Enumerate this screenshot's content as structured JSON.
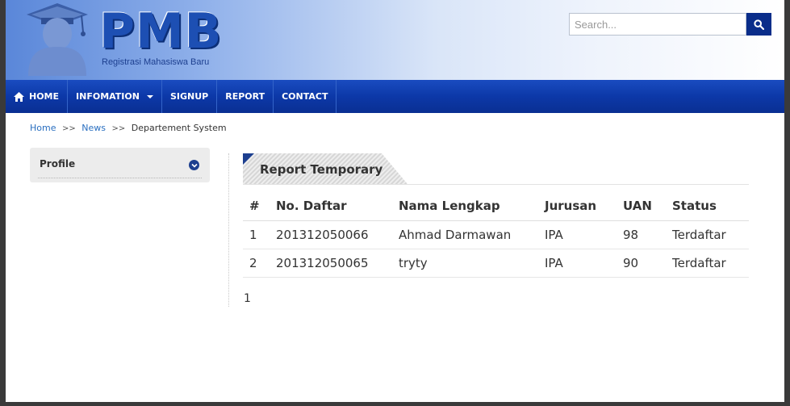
{
  "header": {
    "logo_text": "PMB",
    "logo_subtitle": "Registrasi Mahasiswa Baru",
    "search_placeholder": "Search..."
  },
  "nav": {
    "items": [
      {
        "label": "HOME"
      },
      {
        "label": "INFOMATION"
      },
      {
        "label": "SIGNUP"
      },
      {
        "label": "REPORT"
      },
      {
        "label": "CONTACT"
      }
    ]
  },
  "breadcrumb": {
    "items": [
      "Home",
      "News",
      "Departement System"
    ],
    "separator": ">>"
  },
  "sidebar": {
    "title": "Profile"
  },
  "main": {
    "heading": "Report Temporary",
    "table": {
      "headers": [
        "#",
        "No. Daftar",
        "Nama Lengkap",
        "Jurusan",
        "UAN",
        "Status"
      ],
      "rows": [
        [
          "1",
          "201312050066",
          "Ahmad Darmawan",
          "IPA",
          "98",
          "Terdaftar"
        ],
        [
          "2",
          "201312050065",
          "tryty",
          "IPA",
          "90",
          "Terdaftar"
        ]
      ]
    },
    "pagination": "1"
  },
  "colors": {
    "nav_bg": "#0c38a8",
    "brand_blue": "#1d4fb3",
    "link": "#2a6fc0",
    "search_button": "#0a2d8a"
  }
}
